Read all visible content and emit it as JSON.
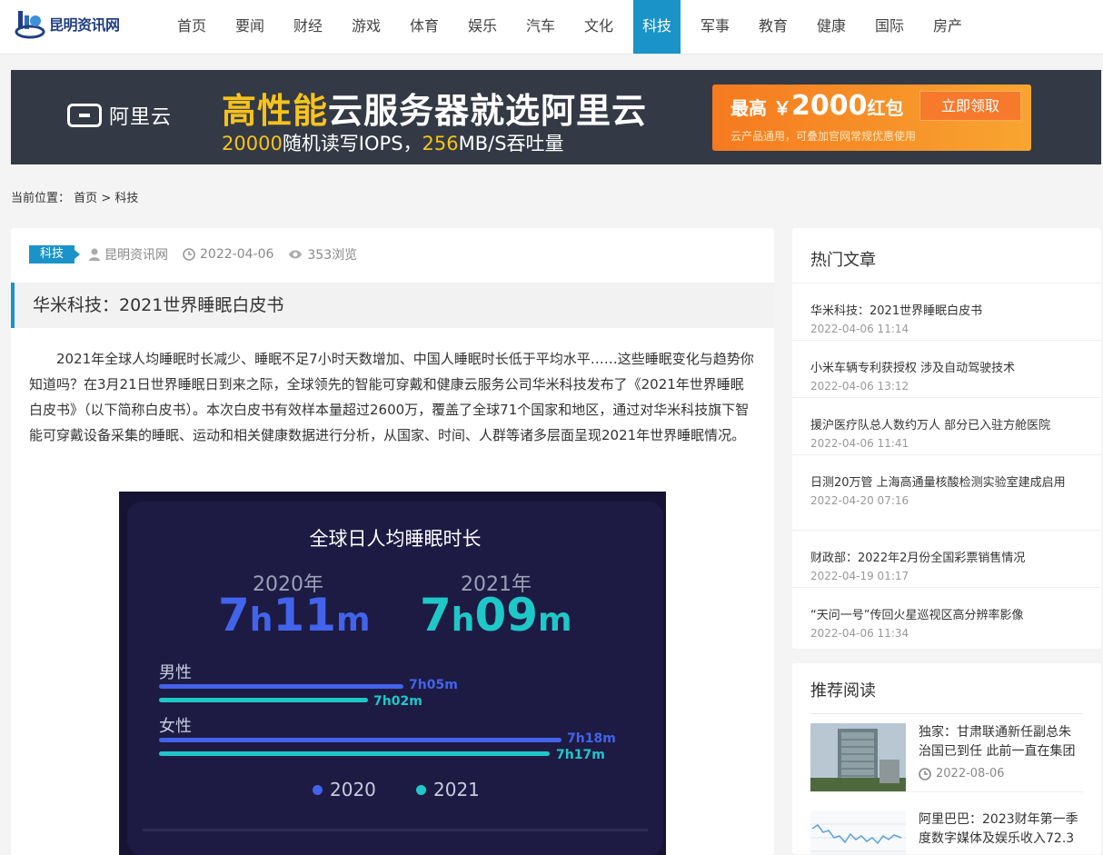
{
  "site": {
    "logo_text": "昆明资讯网"
  },
  "nav": [
    "首页",
    "要闻",
    "财经",
    "游戏",
    "体育",
    "娱乐",
    "汽车",
    "文化",
    "科技",
    "军事",
    "教育",
    "健康",
    "国际",
    "房产"
  ],
  "nav_active": "科技",
  "banner": {
    "brand": "阿里云",
    "main_hl": "高性能",
    "main_rest": "云服务器就选阿里云",
    "sub_1": "20000",
    "sub_2": "随机读写IOPS，",
    "sub_3": "256",
    "sub_4": "MB/S吞吐量",
    "amount_prefix": "最高",
    "amount_currency": "￥",
    "amount_value": "2000",
    "amount_suffix": "红包",
    "cta": "立即领取",
    "note": "云产品通用，可叠加官网常规优惠使用"
  },
  "breadcrumb": {
    "prefix": "当前位置：",
    "home": "首页",
    "sep": ">",
    "current": "科技"
  },
  "article": {
    "tag": "科技",
    "author": "昆明资讯网",
    "date": "2022-04-06",
    "views": "353浏览",
    "title": "华米科技：2021世界睡眠白皮书",
    "body": "2021年全球人均睡眠时长减少、睡眠不足7小时天数增加、中国人睡眠时长低于平均水平……这些睡眠变化与趋势你知道吗？在3月21日世界睡眠日到来之际，全球领先的智能可穿戴和健康云服务公司华米科技发布了《2021年世界睡眠白皮书》（以下简称白皮书）。本次白皮书有效样本量超过2600万，覆盖了全球71个国家和地区，通过对华米科技旗下智能可穿戴设备采集的睡眠、运动和相关健康数据进行分析，从国家、时间、人群等诸多层面呈现2021年世界睡眠情况。"
  },
  "infographic": {
    "title": "全球日人均睡眠时长",
    "year_a": "2020年",
    "year_b": "2021年",
    "total_a": {
      "h": "7",
      "hu": "h",
      "m": "11",
      "mu": "m"
    },
    "total_b": {
      "h": "7",
      "hu": "h",
      "m": "09",
      "mu": "m"
    },
    "male_label": "男性",
    "female_label": "女性",
    "male_2020": "7h05m",
    "male_2021": "7h02m",
    "female_2020": "7h18m",
    "female_2021": "7h17m",
    "legend_a": "2020",
    "legend_b": "2021",
    "colors": {
      "c2020": "#4263eb",
      "c2021": "#1ec8c8"
    }
  },
  "hot": {
    "title": "热门文章",
    "items": [
      {
        "title": "华米科技：2021世界睡眠白皮书",
        "date": "2022-04-06 11:14"
      },
      {
        "title": "小米车辆专利获授权 涉及自动驾驶技术",
        "date": "2022-04-06 13:12"
      },
      {
        "title": "援沪医疗队总人数约万人 部分已入驻方舱医院",
        "date": "2022-04-06 11:41"
      },
      {
        "title": "日测20万管 上海高通量核酸检测实验室建成启用",
        "date": "2022-04-20 07:16"
      },
      {
        "title": "财政部：2022年2月份全国彩票销售情况",
        "date": "2022-04-19 01:17"
      },
      {
        "title": "“天问一号”传回火星巡视区高分辨率影像",
        "date": "2022-04-06 11:34"
      }
    ]
  },
  "rec": {
    "title": "推荐阅读",
    "items": [
      {
        "title": "独家：甘肃联通新任副总朱治国已到任 此前一直在集团",
        "date": "2022-08-06"
      },
      {
        "title": "阿里巴巴：2023财年第一季度数字媒体及娱乐收入72.3",
        "date": ""
      }
    ]
  }
}
